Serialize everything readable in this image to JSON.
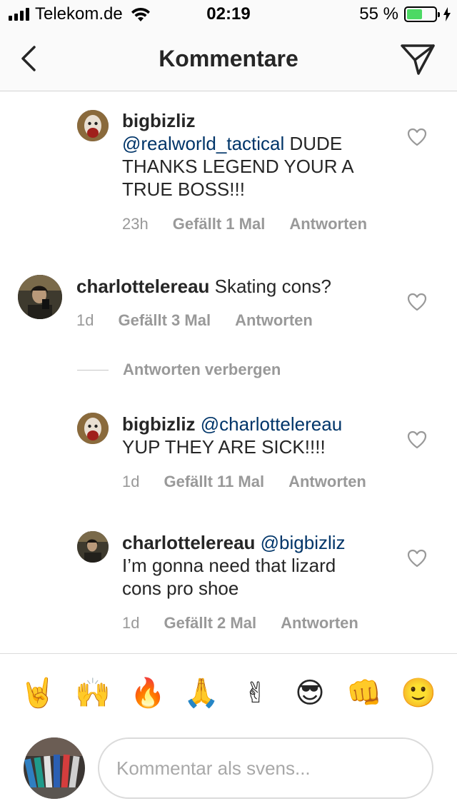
{
  "status_bar": {
    "carrier": "Telekom.de",
    "time": "02:19",
    "battery_percent": "55 %",
    "battery_level": 0.55,
    "signal_bars": 4
  },
  "nav": {
    "title": "Kommentare",
    "back_icon": "chevron-left-icon",
    "send_icon": "paper-plane-icon"
  },
  "comments": [
    {
      "user": "bigbizliz",
      "mention": "@realworld_tactical",
      "text_line1_rest": " DUDE",
      "text_lines": [
        "THANKS LEGEND YOUR A",
        "TRUE BOSS!!!"
      ],
      "time": "23h",
      "likes": "Gefällt 1 Mal",
      "reply": "Antworten"
    },
    {
      "user": "charlottelereau",
      "text": " Skating cons?",
      "time": "1d",
      "likes": "Gefällt 3 Mal",
      "reply": "Antworten"
    },
    {
      "user": "bigbizliz",
      "mention": "@charlottelereau",
      "text_lines": [
        "YUP THEY ARE SICK!!!!"
      ],
      "time": "1d",
      "likes": "Gefällt 11 Mal",
      "reply": "Antworten"
    },
    {
      "user": "charlottelereau",
      "mention": "@bigbizliz",
      "text_lines": [
        "I’m gonna need that lizard",
        "cons pro shoe"
      ],
      "time": "1d",
      "likes": "Gefällt 2 Mal",
      "reply": "Antworten"
    }
  ],
  "hide_replies_label": "Antworten verbergen",
  "emojis": [
    "🤘",
    "🙌",
    "🔥",
    "🙏",
    "✌",
    "😎",
    "👊",
    "🙂"
  ],
  "input": {
    "placeholder": "Kommentar als svens..."
  },
  "colors": {
    "mention": "#003569",
    "meta": "#999999",
    "battery": "#4cd964"
  }
}
